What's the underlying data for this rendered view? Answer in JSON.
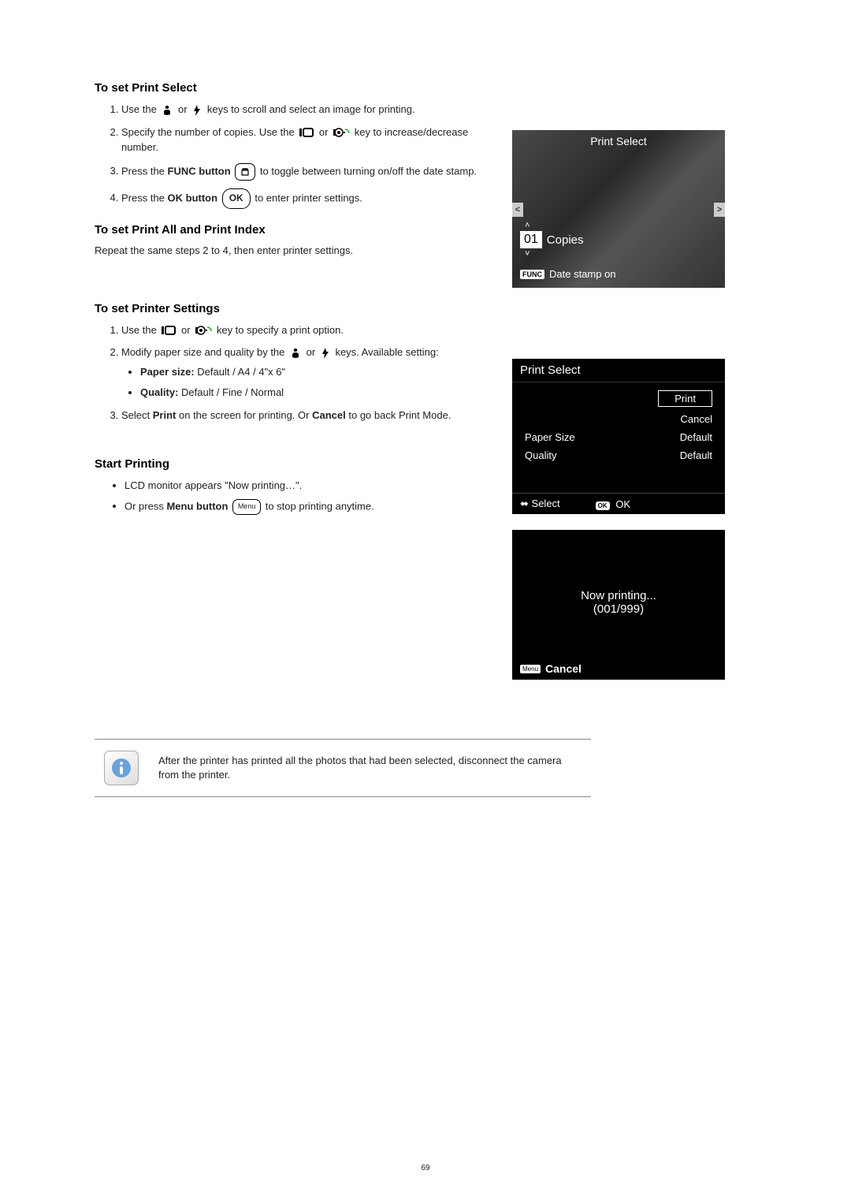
{
  "sections": {
    "s1": {
      "title": "To set Print Select",
      "step1_a": "Use the ",
      "step1_b": " or ",
      "step1_c": " keys to scroll and select an image for printing.",
      "step2_a": "Specify the number of copies. Use the ",
      "step2_b": " or ",
      "step2_c": " key to increase/decrease number.",
      "step3_a": "Press the ",
      "step3_b": "FUNC button",
      "step3_c": " to toggle between turning on/off the date stamp.",
      "step4_a": "Press the ",
      "step4_b": "OK button",
      "step4_c": " to enter printer settings."
    },
    "s2": {
      "title": "To set Print All and Print Index",
      "text": "Repeat the same steps 2 to 4, then enter printer settings."
    },
    "s3": {
      "title": "To set Printer Settings",
      "step1_a": "Use the ",
      "step1_b": " or ",
      "step1_c": " key to specify a print option.",
      "step2_a": "Modify paper size and quality by the ",
      "step2_b": " or ",
      "step2_c": " keys. Available setting:",
      "bullet1_label": "Paper size:",
      "bullet1_val": " Default / A4 / 4\"x 6\"",
      "bullet2_label": "Quality:",
      "bullet2_val": " Default / Fine / Normal",
      "step3_a": "Select ",
      "step3_b": "Print",
      "step3_c": " on the screen for printing. Or ",
      "step3_d": "Cancel",
      "step3_e": " to go back Print Mode."
    },
    "s4": {
      "title": "Start Printing",
      "bullet1": "LCD monitor appears \"Now printing…\".",
      "bullet2_a": "Or press ",
      "bullet2_b": "Menu button",
      "bullet2_c": " to stop printing anytime."
    }
  },
  "lcd1": {
    "title": "Print Select",
    "copies_num": "01",
    "copies_label": "Copies",
    "func_badge": "FUNC",
    "datestamp": "Date stamp on"
  },
  "lcd2": {
    "title": "Print Select",
    "left_items": [
      "Paper Size",
      "Quality"
    ],
    "right_items": [
      "Print",
      "Cancel",
      "Default",
      "Default"
    ],
    "foot_select": "Select",
    "foot_ok": "OK"
  },
  "lcd3": {
    "line1": "Now printing...",
    "line2": "(001/999)",
    "menu_badge": "Menu",
    "cancel": "Cancel"
  },
  "note": "After the printer has printed all the photos that had been selected, disconnect the camera from the printer.",
  "icon_labels": {
    "ok": "OK",
    "menu": "Menu",
    "ok_badge": "OK"
  },
  "page_num": "69"
}
